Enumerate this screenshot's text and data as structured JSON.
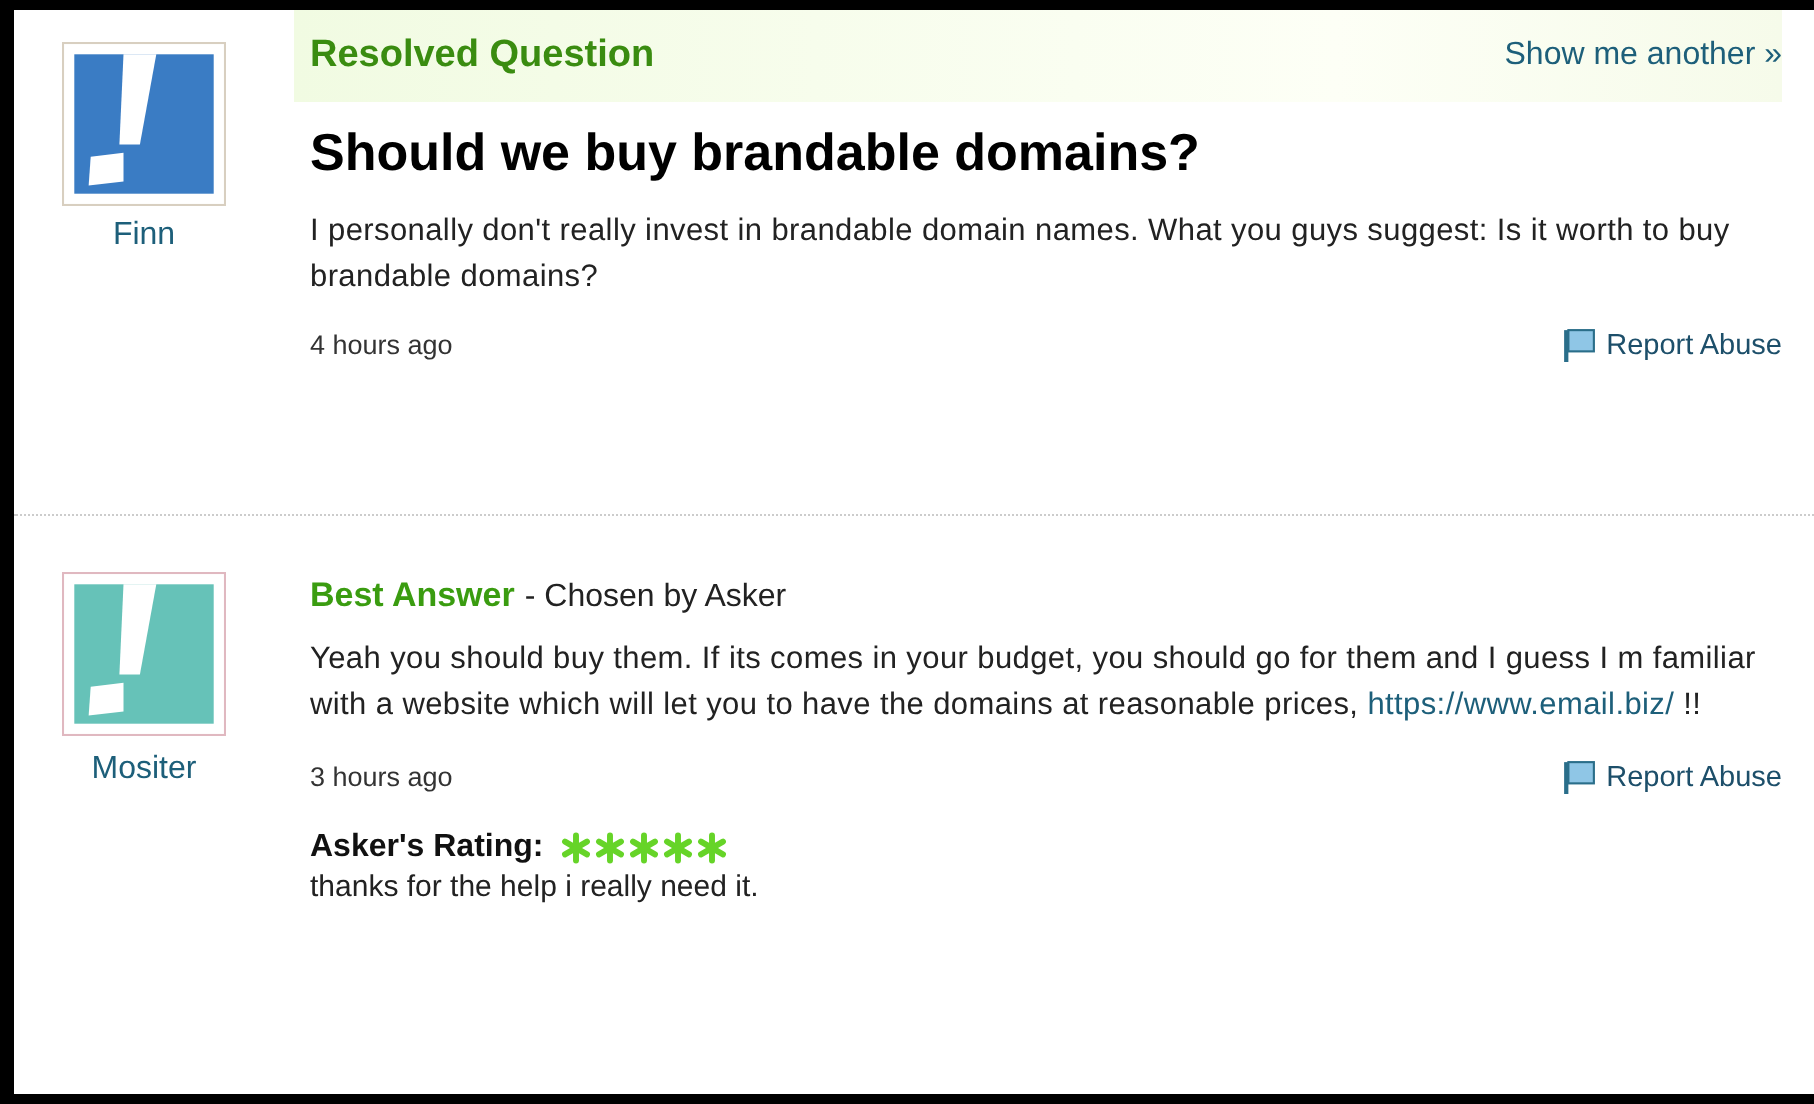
{
  "question": {
    "status": "Resolved Question",
    "show_another": "Show me another »",
    "author": "Finn",
    "title": "Should we buy brandable domains?",
    "body": "I personally don't really invest in brandable domain names. What you guys suggest: Is it worth to buy brandable domains?",
    "time": "4 hours ago",
    "report": "Report Abuse"
  },
  "answer": {
    "label": "Best Answer",
    "chosen": "- Chosen by Asker",
    "author": "Mositer",
    "body_before": "Yeah you should buy them. If its comes in your budget, you should go for them and I guess I m familiar with a website which will let you to have the domains at reasonable prices,",
    "link": "https://www.email.biz/",
    "body_after": "!!",
    "time": "3 hours ago",
    "report": "Report Abuse",
    "rating": {
      "label": "Asker's Rating:",
      "stars": 5,
      "comment": "thanks for the help i really need it."
    }
  }
}
